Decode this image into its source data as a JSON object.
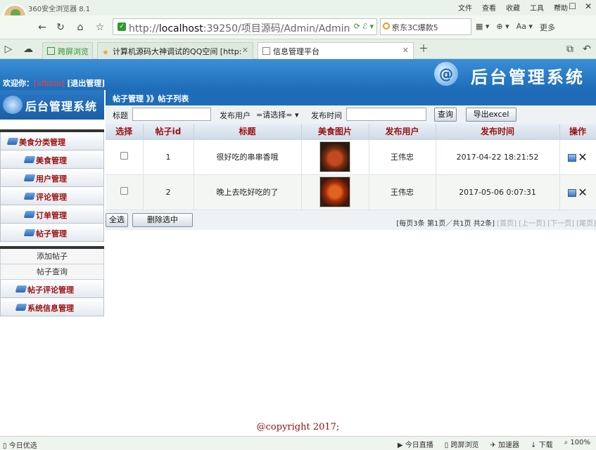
{
  "browser": {
    "title": "360安全浏览器 8.1",
    "menus": [
      "文件",
      "查看",
      "收藏",
      "工具",
      "帮助"
    ],
    "url_prefix": "http://",
    "url_host": "localhost",
    "url_rest": ":39250/项目源码/Admin/Admin",
    "search_text": "京东3C爆款5",
    "tools_more": "更多",
    "tabs": [
      "跨屏浏览",
      "计算机源码大神调试的QQ空间 [http:",
      "信息管理平台"
    ],
    "status_left": "今日优选",
    "status_items": [
      "今日直播",
      "跨屏浏览",
      "加速器",
      "下载",
      "100%"
    ]
  },
  "header": {
    "welcome_label": "欢迎你：",
    "username": "[admin]",
    "logout": "[退出管理]",
    "brand": "后台管理系统",
    "brand_logo": "@"
  },
  "sidebar": {
    "title": "后台管理系统",
    "items": [
      "美食分类管理",
      "美食管理",
      "用户管理",
      "评论管理",
      "订单管理",
      "帖子管理"
    ],
    "subitems": [
      "添加帖子",
      "帖子查询"
    ],
    "items_after": [
      "帖子评论管理",
      "系统信息管理"
    ]
  },
  "breadcrumb": "帖子管理 》》帖子列表",
  "filter": {
    "title_label": "标题",
    "title_value": "",
    "user_label": "发布用户",
    "user_select": "=请选择=",
    "time_label": "发布时间",
    "time_value": "",
    "query_button": "查询",
    "export_button": "导出excel"
  },
  "table": {
    "columns": [
      "选择",
      "帖子id",
      "标题",
      "美食图片",
      "发布用户",
      "发布时间",
      "操作"
    ],
    "rows": [
      {
        "id": "1",
        "title": "很好吃的串串香哦",
        "user": "王伟忠",
        "time": "2017-04-22 18:21:52"
      },
      {
        "id": "2",
        "title": "晚上去吃好吃的了",
        "user": "王伟忠",
        "time": "2017-05-06 0:07:31"
      }
    ]
  },
  "pager": {
    "select_all": "全选",
    "delete_selected": "删除选中",
    "info": "[每页3条 第1页／共1页 共2条]",
    "first": "[首页]",
    "prev": "[上一页]",
    "next": "[下一页]",
    "last": "[尾页]"
  },
  "footer": "@copyright 2017;",
  "colors": {
    "header_blue": "#1e6cb8",
    "menu_text": "#9b1010",
    "username_red": "#ff3b3b"
  }
}
